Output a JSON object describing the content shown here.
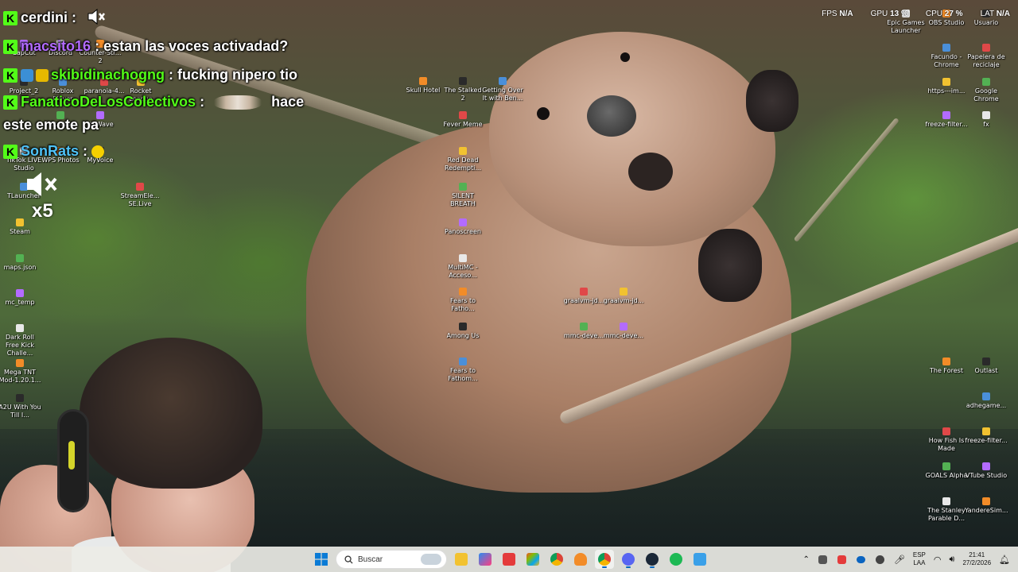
{
  "chat": {
    "lines": [
      {
        "user": "cerdini",
        "sep": ":",
        "message": ""
      },
      {
        "user": "macsito16",
        "sep": ":",
        "message": "estan las voces activadad?"
      },
      {
        "user": "skibidinachogng",
        "sep": ":",
        "message": "fucking nipero tio"
      },
      {
        "user": "FanaticoDeLosColectivos",
        "sep": ":",
        "message": "hace"
      },
      {
        "user": "",
        "sep": "",
        "message": "este emote pa"
      },
      {
        "user": "SonRats",
        "sep": ":",
        "message": ""
      }
    ],
    "user_colors": [
      "#ffffff",
      "#b36bff",
      "#53fc18",
      "#53fc18",
      "#ffffff",
      "#4fc3f7"
    ],
    "mute_count": "x5"
  },
  "perf": {
    "fps_label": "FPS",
    "fps_value": "N/A",
    "gpu_label": "GPU",
    "gpu_value": "13 %",
    "cpu_label": "CPU",
    "cpu_value": "27 %",
    "lat_label": "LAT",
    "lat_value": "N/A"
  },
  "desktop_icons": {
    "left": [
      {
        "label": "CapCut"
      },
      {
        "label": "Discord"
      },
      {
        "label": "Counter-Str... 2"
      },
      {
        "label": "Project_2"
      },
      {
        "label": "Roblox Player"
      },
      {
        "label": "paranoia-4..."
      },
      {
        "label": "Rocket League"
      },
      {
        "label": "Studio"
      },
      {
        "label": "NXWave"
      },
      {
        "label": "TikTok LIVE Studio"
      },
      {
        "label": "WPS Photos"
      },
      {
        "label": "MyVoice"
      },
      {
        "label": "TLauncher"
      },
      {
        "label": "StreamEle... SE.Live"
      },
      {
        "label": "Steam"
      },
      {
        "label": "maps.json"
      },
      {
        "label": "mc_temp"
      },
      {
        "label": "Dark Roll Free Kick Challe..."
      },
      {
        "label": "Mega TNT Mod-1.20.1..."
      },
      {
        "label": "A2U With You Till I..."
      }
    ],
    "middle": [
      {
        "label": "Skull Hotel"
      },
      {
        "label": "The Stalked 2"
      },
      {
        "label": "Getting Over It with Ben..."
      },
      {
        "label": "Fever Meme"
      },
      {
        "label": "Red Dead Redempti..."
      },
      {
        "label": "SILENT BREATH"
      },
      {
        "label": "Panoscreen"
      },
      {
        "label": "MultiMC - Acceso..."
      },
      {
        "label": "Fears to Fatho..."
      },
      {
        "label": "Among Us"
      },
      {
        "label": "Fears to Fathom..."
      },
      {
        "label": "graalvm-jd..."
      },
      {
        "label": "graalvm-jd..."
      },
      {
        "label": "mmc-deve..."
      },
      {
        "label": "mmc-deve..."
      }
    ],
    "right": [
      {
        "label": "Epic Games Launcher"
      },
      {
        "label": "OBS Studio"
      },
      {
        "label": "Usuario"
      },
      {
        "label": "Facundo - Chrome"
      },
      {
        "label": "Papelera de reciclaje"
      },
      {
        "label": "https---im..."
      },
      {
        "label": "Google Chrome"
      },
      {
        "label": "freeze-filter..."
      },
      {
        "label": "fx"
      },
      {
        "label": "The Forest"
      },
      {
        "label": "Outlast"
      },
      {
        "label": "adhegame..."
      },
      {
        "label": "How Fish Is Made"
      },
      {
        "label": "freeze-filter..."
      },
      {
        "label": "GOALS Alpha"
      },
      {
        "label": "VTube Studio"
      },
      {
        "label": "The Stanley Parable D..."
      },
      {
        "label": "YandereSim..."
      }
    ]
  },
  "taskbar": {
    "search_placeholder": "Buscar",
    "lang_top": "ESP",
    "lang_bottom": "LAA",
    "time": "21:41",
    "date": "27/2/2026",
    "pinned": [
      "start",
      "search",
      "explorer",
      "store-widget",
      "wps",
      "ms-store",
      "chrome",
      "flame",
      "chrome-profile",
      "discord",
      "steam",
      "spotify",
      "notepad"
    ]
  },
  "colors": {
    "kick_green": "#53fc18",
    "taskbar_bg": "#ebebe6",
    "accent": "#0067c0"
  }
}
